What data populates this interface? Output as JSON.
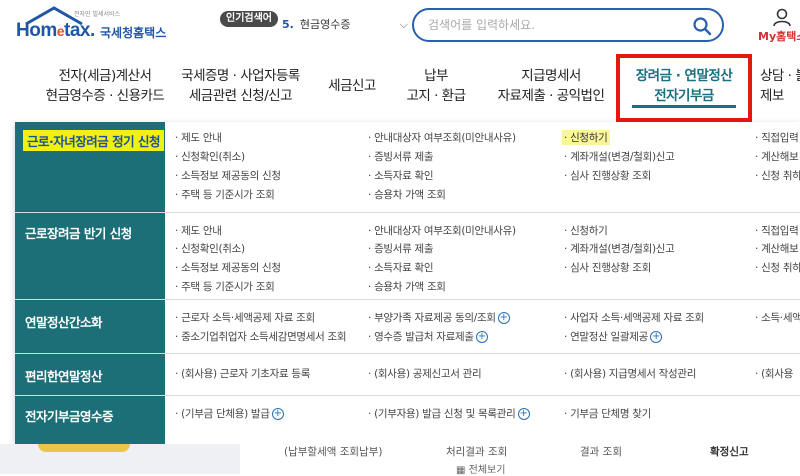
{
  "header": {
    "logo_text_a": "Hom",
    "logo_text_e": "e",
    "logo_text_b": "tax.",
    "logo_korean": "국세청홈택스",
    "logo_small": "전자민 빌세서비스",
    "popular_badge": "인기검색어",
    "popular_rank": "5.",
    "popular_term": "현금영수증",
    "search_placeholder": "검색어를 입력하세요.",
    "myhometax_label": "My홈택스"
  },
  "gnb": [
    {
      "line1": "전자(세금)계산서",
      "line2": "현금영수증 · 신용카드"
    },
    {
      "line1": "국세증명 · 사업자등록",
      "line2": "세금관련 신청/신고"
    },
    {
      "line1": "세금신고",
      "line2": ""
    },
    {
      "line1": "납부",
      "line2": "고지 · 환급"
    },
    {
      "line1": "지급명세서",
      "line2": "자료제출 · 공익법인"
    },
    {
      "line1": "장려금 · 연말정산",
      "line2": "전자기부금"
    },
    {
      "line1": "상담 · 불",
      "line2": "제보"
    }
  ],
  "sections": [
    {
      "title": "근로·자녀장려금 정기 신청",
      "items": [
        [
          "· 제도 안내",
          "· 신청확인(취소)",
          "· 소득정보 제공동의 신청",
          "· 주택 등 기준시가 조회"
        ],
        [
          "· 안내대상자 여부조회(미안내사유)",
          "· 증빙서류 제출",
          "· 소득자료 확인",
          "· 승용차 가액 조회"
        ],
        [
          "· 신청하기",
          "· 계좌개설(변경/철회)신고",
          "· 심사 진행상황 조회"
        ],
        [
          "· 직접입력",
          "· 계산해보",
          "· 신청 취하"
        ]
      ]
    },
    {
      "title": "근로장려금 반기 신청",
      "items": [
        [
          "· 제도 안내",
          "· 신청확인(취소)",
          "· 소득정보 제공동의 신청",
          "· 주택 등 기준시가 조회"
        ],
        [
          "· 안내대상자 여부조회(미안내사유)",
          "· 증빙서류 제출",
          "· 소득자료 확인",
          "· 승용차 가액 조회"
        ],
        [
          "· 신청하기",
          "· 계좌개설(변경/철회)신고",
          "· 심사 진행상황 조회"
        ],
        [
          "· 직접입력",
          "· 계산해보",
          "· 신청 취하"
        ]
      ]
    },
    {
      "title": "연말정산간소화",
      "items": [
        [
          "· 근로자 소득·세액공제 자료 조회",
          "· 중소기업취업자 소득세감면명세서 조회"
        ],
        [
          "· 부양가족 자료제공 동의/조회",
          "· 영수증 발급처 자료제출"
        ],
        [
          "· 사업자 소득·세액공제 자료 조회",
          "· 연말정산 일괄제공"
        ],
        [
          "· 소득·세액"
        ]
      ]
    },
    {
      "title": "편리한연말정산",
      "items": [
        [
          "· (회사용) 근로자 기초자료 등록"
        ],
        [
          "· (회사용) 공제신고서 관리"
        ],
        [
          "· (회사용) 지급명세서 작성관리"
        ],
        [
          "· (회사용"
        ]
      ]
    },
    {
      "title": "전자기부금영수증",
      "items": [
        [
          "· (기부금 단체용) 발급"
        ],
        [
          "· (기부자용) 발급 신청 및 목록관리"
        ],
        [
          "· 기부금 단체명 찾기"
        ],
        []
      ]
    }
  ],
  "bottom": {
    "t1": "(납부할세액 조회납부)",
    "t2": "처리결과 조회",
    "t3": "결과 조회",
    "t4": "확정신고",
    "t5": "전체보기"
  },
  "colors": {
    "brand_blue": "#1f57a8",
    "menu_teal": "#1c6e77",
    "active_teal": "#1a6f80",
    "highlight_red": "#e3190f",
    "highlight_yellow": "#f2f00e"
  }
}
